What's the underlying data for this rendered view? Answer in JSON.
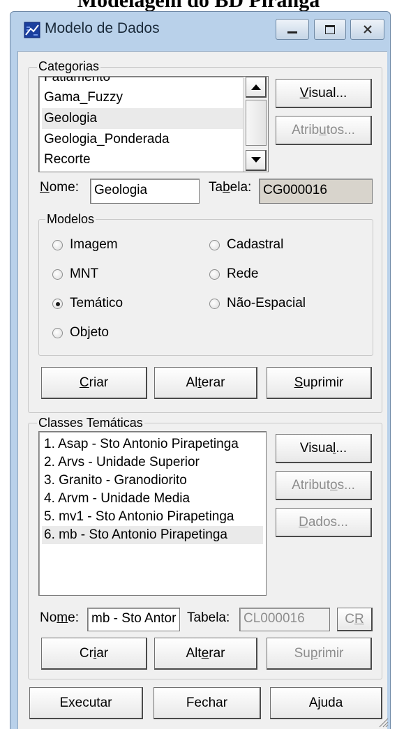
{
  "page_title": "Modelagem do BD Piranga",
  "window": {
    "title": "Modelo de Dados"
  },
  "categorias": {
    "legend": "Categorias",
    "items": [
      "Fatiamento",
      "Gama_Fuzzy",
      "Geologia",
      "Geologia_Ponderada",
      "Recorte"
    ],
    "selected": "Geologia",
    "visual_button": {
      "pre": "",
      "u": "V",
      "post": "isual..."
    },
    "atributos_button": {
      "pre": "Atrib",
      "u": "u",
      "post": "tos..."
    },
    "nome_label": {
      "u": "N",
      "post": "ome:"
    },
    "nome_value": "Geologia",
    "tabela_label": {
      "pre": "Ta",
      "u": "b",
      "post": "ela:"
    },
    "tabela_value": "CG000016"
  },
  "modelos": {
    "legend": "Modelos",
    "options": [
      "Imagem",
      "Cadastral",
      "MNT",
      "Rede",
      "Temático",
      "Não-Espacial",
      "Objeto"
    ],
    "selected": "Temático"
  },
  "category_actions": {
    "criar": {
      "pre": "",
      "u": "C",
      "post": "riar"
    },
    "alterar": {
      "pre": "Al",
      "u": "t",
      "post": "erar"
    },
    "suprimir": {
      "pre": "",
      "u": "S",
      "post": "uprimir"
    }
  },
  "classes": {
    "legend": "Classes Temáticas",
    "items": [
      "1. Asap - Sto Antonio Pirapetinga",
      "2. Arvs - Unidade Superior",
      "3. Granito - Granodiorito",
      "4. Arvm - Unidade Media",
      "5. mv1 - Sto Antonio Pirapetinga",
      "6. mb - Sto Antonio Pirapetinga"
    ],
    "selected": "6. mb - Sto Antonio Pirapetinga",
    "visual_button": {
      "pre": "Visua",
      "u": "l",
      "post": "..."
    },
    "atributos_button": {
      "pre": "Atribut",
      "u": "o",
      "post": "s..."
    },
    "dados_button": {
      "pre": "",
      "u": "D",
      "post": "ados..."
    },
    "nome_label": {
      "pre": "No",
      "u": "m",
      "post": "e:"
    },
    "nome_value": "mb - Sto Antor",
    "tabela_label": "Tabela:",
    "tabela_value": "CL000016",
    "cr_button": {
      "pre": "C",
      "u": "R",
      "post": ""
    },
    "criar": {
      "pre": "Cr",
      "u": "i",
      "post": "ar"
    },
    "alterar": {
      "pre": "Alt",
      "u": "e",
      "post": "rar"
    },
    "suprimir": {
      "pre": "Su",
      "u": "p",
      "post": "rimir"
    }
  },
  "footer": {
    "executar": "Executar",
    "fechar": "Fechar",
    "ajuda": "Ajuda"
  },
  "colors": {
    "frame": "#b9d1ea",
    "face": "#f0f0f0",
    "selection": "#eaeaea",
    "disabled_text": "#8d8d8d"
  }
}
